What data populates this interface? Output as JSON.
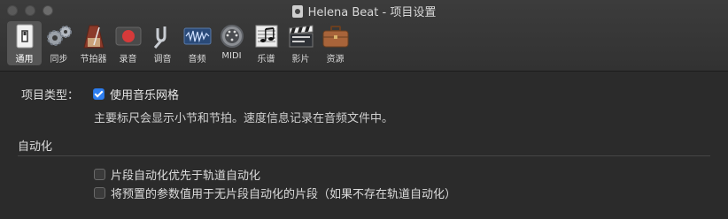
{
  "window": {
    "title": "Helena Beat - 项目设置"
  },
  "toolbar": {
    "items": [
      {
        "label": "通用",
        "icon": "general-icon",
        "selected": true
      },
      {
        "label": "同步",
        "icon": "sync-gears-icon"
      },
      {
        "label": "节拍器",
        "icon": "metronome-icon"
      },
      {
        "label": "录音",
        "icon": "record-icon"
      },
      {
        "label": "调音",
        "icon": "tuning-fork-icon"
      },
      {
        "label": "音频",
        "icon": "audio-waveform-icon"
      },
      {
        "label": "MIDI",
        "icon": "midi-connector-icon"
      },
      {
        "label": "乐谱",
        "icon": "score-notes-icon"
      },
      {
        "label": "影片",
        "icon": "movie-clapper-icon"
      },
      {
        "label": "资源",
        "icon": "assets-briefcase-icon"
      }
    ]
  },
  "project": {
    "type_label": "项目类型：",
    "use_musical_grid": {
      "label": "使用音乐网格",
      "checked": true
    },
    "description": "主要标尺会显示小节和节拍。速度信息记录在音频文件中。"
  },
  "automation": {
    "section_title": "自动化",
    "options": [
      {
        "label": "片段自动化优先于轨道自动化",
        "checked": false
      },
      {
        "label": "将预置的参数值用于无片段自动化的片段（如果不存在轨道自动化）",
        "checked": false
      }
    ]
  },
  "colors": {
    "accent": "#2d7ef0",
    "background": "#2b2b2b",
    "record": "#d63a3a"
  }
}
